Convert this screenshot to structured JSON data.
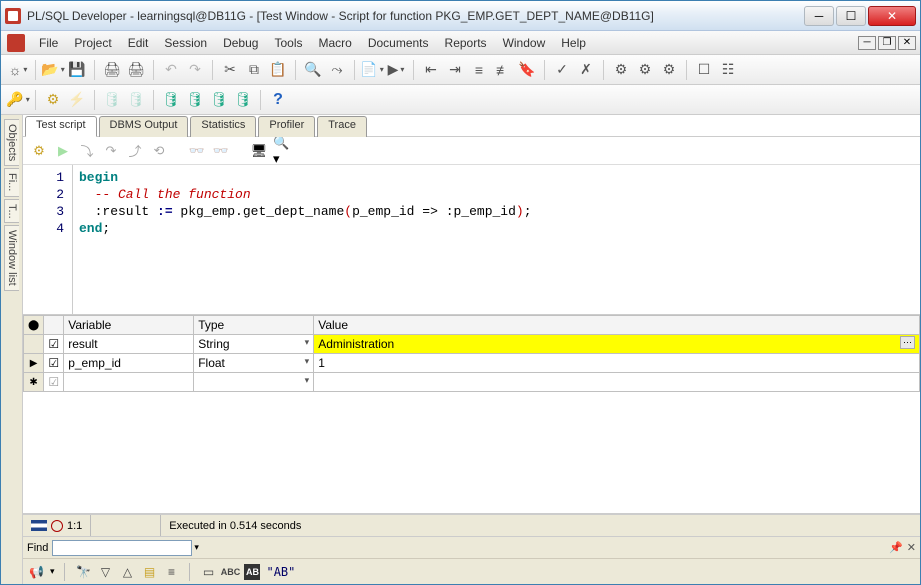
{
  "title": "PL/SQL Developer - learningsql@DB11G - [Test Window - Script for function PKG_EMP.GET_DEPT_NAME@DB11G]",
  "menu": {
    "file": "File",
    "project": "Project",
    "edit": "Edit",
    "session": "Session",
    "debug": "Debug",
    "tools": "Tools",
    "macro": "Macro",
    "documents": "Documents",
    "reports": "Reports",
    "window": "Window",
    "help": "Help"
  },
  "side_tabs": {
    "objects": "Objects",
    "files": "Fi...",
    "templates": "T...",
    "window_list": "Window list"
  },
  "doc_tabs": {
    "test_script": "Test script",
    "dbms_output": "DBMS Output",
    "statistics": "Statistics",
    "profiler": "Profiler",
    "trace": "Trace"
  },
  "code": {
    "line1": "begin",
    "comment": "  -- Call the function",
    "prefix3": "  :result ",
    "assign": ":=",
    "mid3": " pkg_emp.get_dept_name",
    "paropen": "(",
    "args": "p_emp_id => :p_emp_id",
    "parclose": ")",
    "semi": ";",
    "line4": "end",
    "semi4": ";",
    "gutters": {
      "l1": "1",
      "l2": "2",
      "l3": "3",
      "l4": "4"
    }
  },
  "vars": {
    "hdr_status": "",
    "hdr_variable": "Variable",
    "hdr_type": "Type",
    "hdr_value": "Value",
    "row1": {
      "name": "result",
      "type": "String",
      "value": "Administration"
    },
    "row2": {
      "name": "p_emp_id",
      "type": "Float",
      "value": "1"
    }
  },
  "status": {
    "pos": "1:1",
    "msg": "Executed in 0.514 seconds"
  },
  "find": {
    "label": "Find",
    "value": "",
    "quoted": "\"AB\""
  },
  "icons": {
    "bullhorn": "📢",
    "help": "?"
  }
}
